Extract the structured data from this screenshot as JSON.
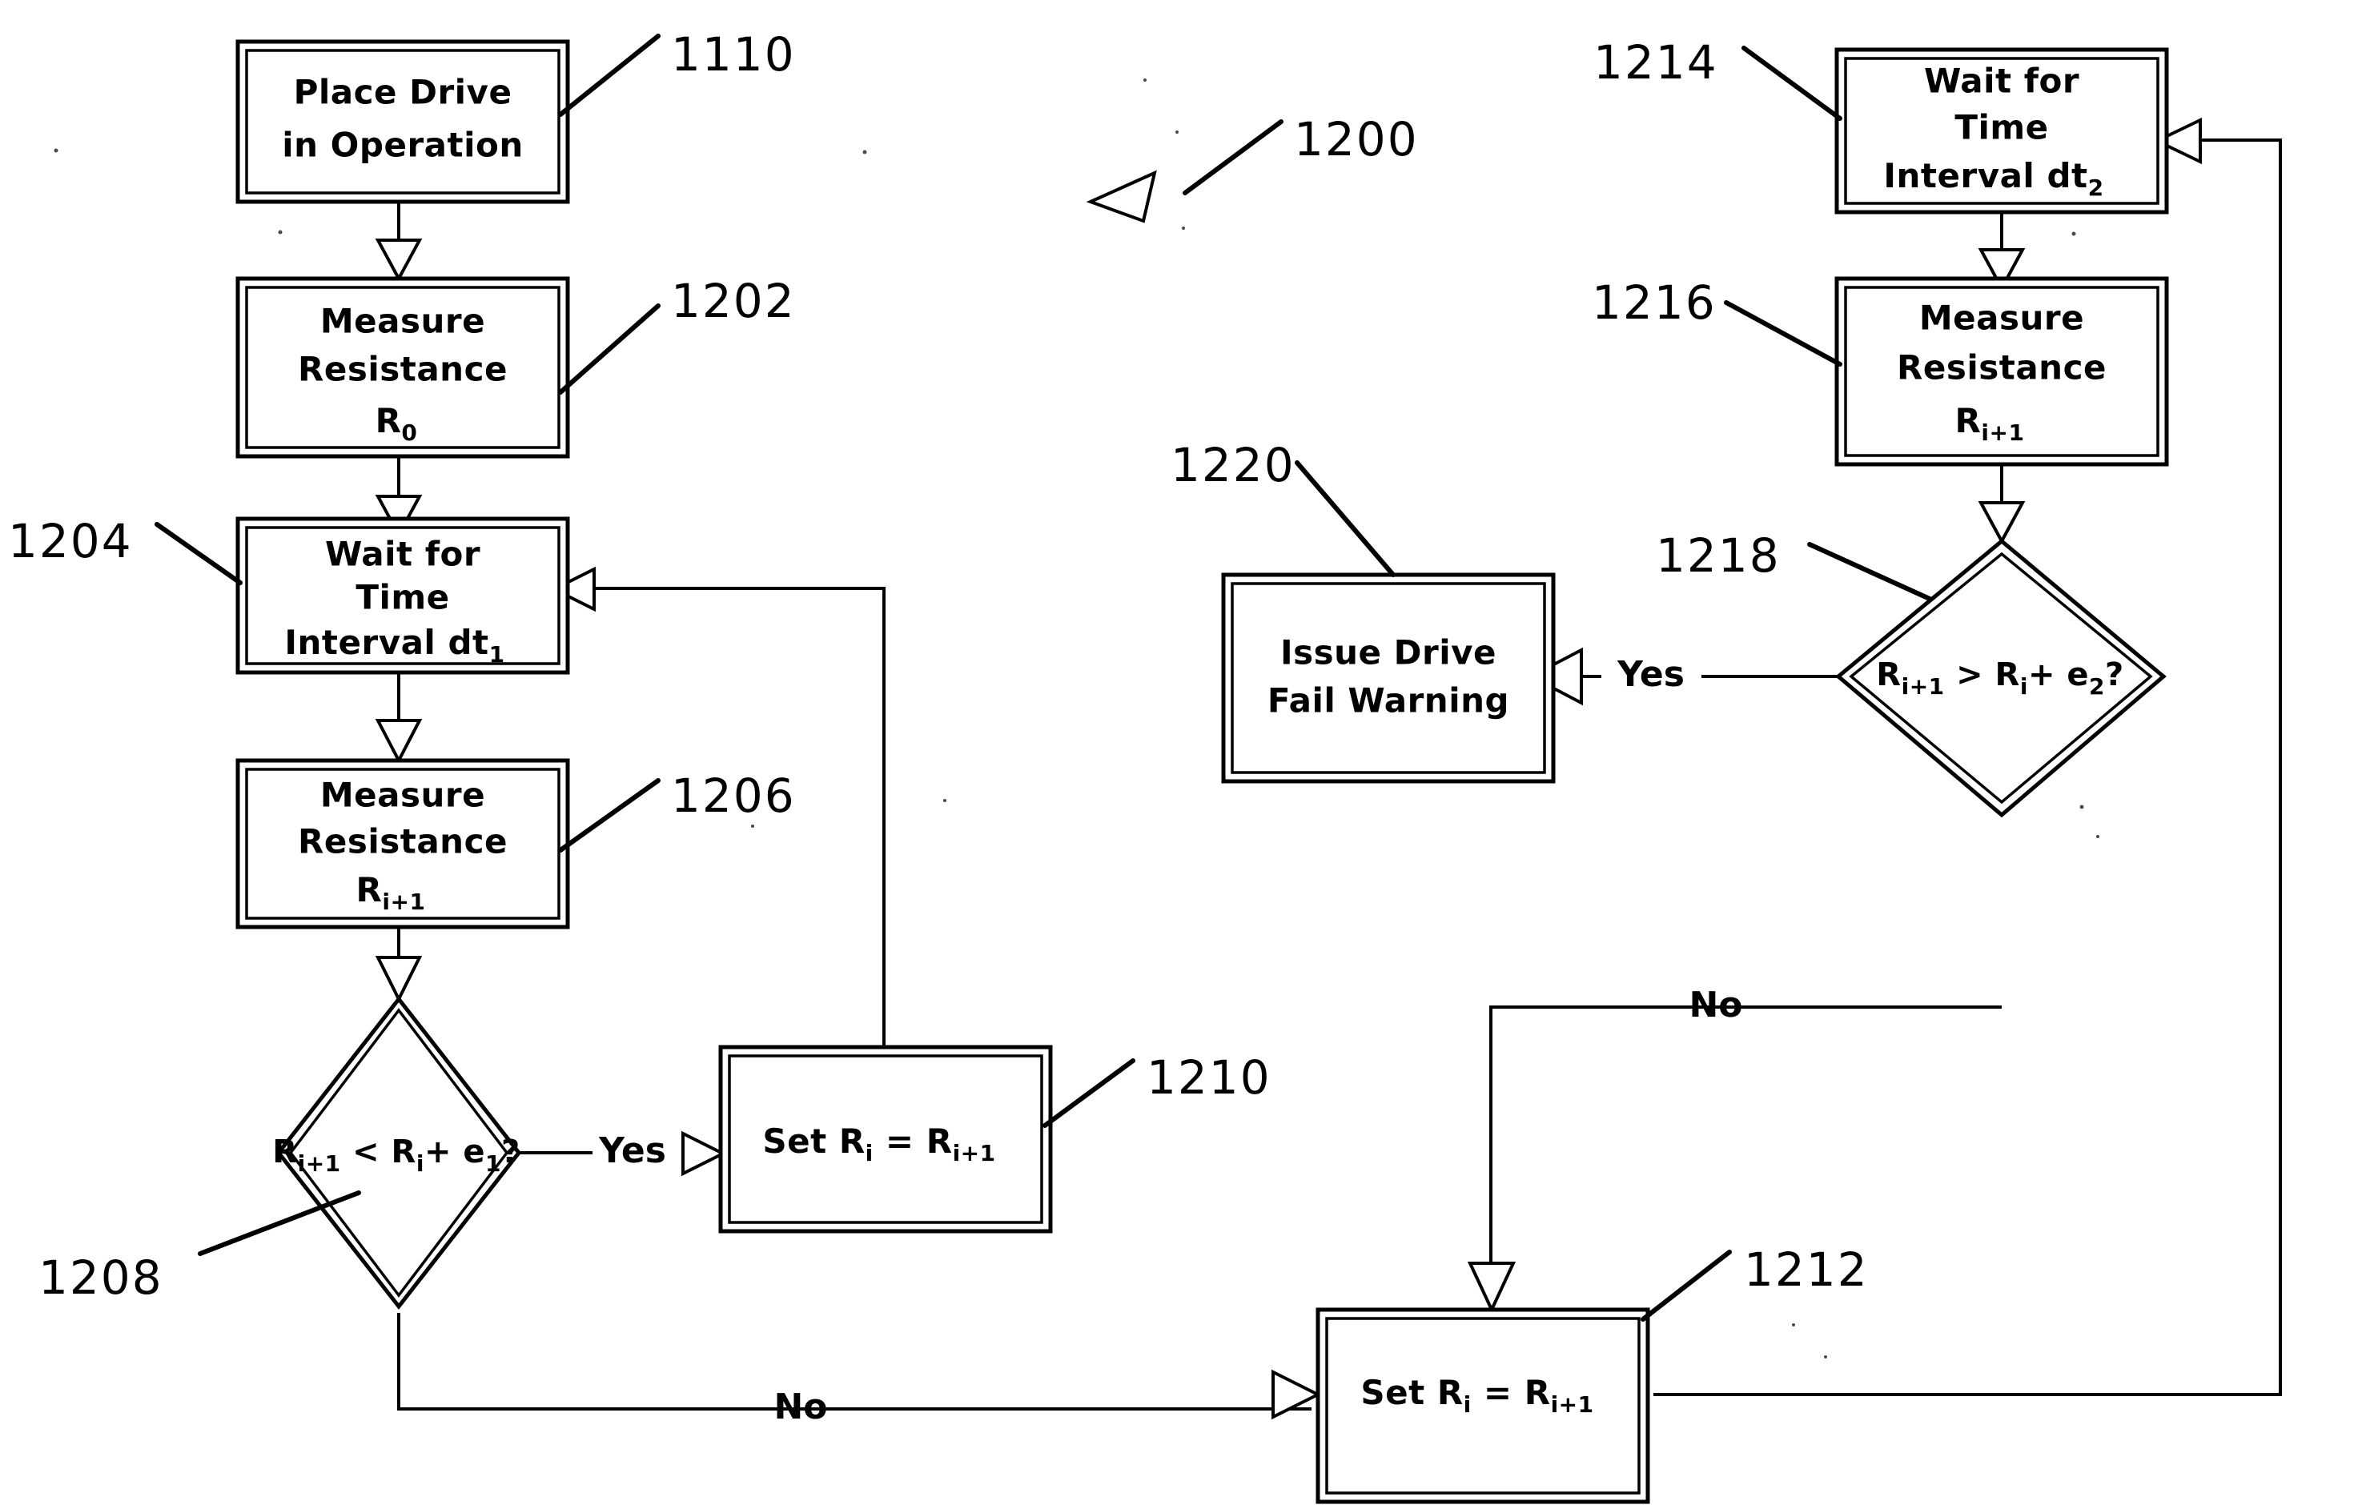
{
  "figure": {
    "name": "figure-1200",
    "reference_numeral": "1200",
    "type": "patent-flowchart",
    "background_color": "#ffffff",
    "line_color": "#000000"
  },
  "nodes": [
    {
      "id": "1110",
      "ref": "1110",
      "shape": "process",
      "lines": [
        "Place Drive",
        "in Operation"
      ]
    },
    {
      "id": "1202",
      "ref": "1202",
      "shape": "process",
      "lines": [
        "Measure",
        "Resistance",
        "R"
      ],
      "subscript": "0"
    },
    {
      "id": "1204",
      "ref": "1204",
      "shape": "process",
      "lines": [
        "Wait for",
        "Time",
        "Interval dt"
      ],
      "subscript": "1"
    },
    {
      "id": "1206",
      "ref": "1206",
      "shape": "process",
      "lines": [
        "Measure",
        "Resistance",
        "R"
      ],
      "subscript": "i+1"
    },
    {
      "id": "1208",
      "ref": "1208",
      "shape": "decision",
      "expr": "R_{i+1} < R_i + e_1 ?",
      "parts": [
        "R",
        "i+1",
        " < ",
        "R",
        "i",
        "+ ",
        "e",
        "1",
        "?"
      ]
    },
    {
      "id": "1210",
      "ref": "1210",
      "shape": "process",
      "expr": "Set R_i = R_{i+1}"
    },
    {
      "id": "1212",
      "ref": "1212",
      "shape": "process",
      "expr": "Set R_i = R_{i+1}"
    },
    {
      "id": "1214",
      "ref": "1214",
      "shape": "process",
      "lines": [
        "Wait for",
        "Time",
        "Interval dt"
      ],
      "subscript": "2"
    },
    {
      "id": "1216",
      "ref": "1216",
      "shape": "process",
      "lines": [
        "Measure",
        "Resistance",
        "R"
      ],
      "subscript": "i+1"
    },
    {
      "id": "1218",
      "ref": "1218",
      "shape": "decision",
      "expr": "R_{i+1} > R_i + e_2 ?"
    },
    {
      "id": "1220",
      "ref": "1220",
      "shape": "process",
      "lines": [
        "Issue Drive",
        "Fail Warning"
      ]
    }
  ],
  "text": {
    "place_drive_l1": "Place Drive",
    "place_drive_l2": "in Operation",
    "measure_l1": "Measure",
    "measure_l2": "Resistance",
    "wait_l1": "Wait for",
    "wait_l2": "Time",
    "wait_l3": "Interval dt",
    "r_symbol": "R",
    "sub_zero": "0",
    "sub_i_plus_1": "i+1",
    "sub_i": "i",
    "sub_1": "1",
    "sub_2": "2",
    "issue_l1": "Issue Drive",
    "issue_l2": "Fail Warning",
    "set_prefix": "Set R",
    "set_eq": " = R",
    "lt_op": " < R",
    "gt_op": " > R",
    "plus_e": "+ e",
    "question": "?",
    "yes": "Yes",
    "no": "No"
  },
  "refs": {
    "r1110": "1110",
    "r1200": "1200",
    "r1202": "1202",
    "r1204": "1204",
    "r1206": "1206",
    "r1208": "1208",
    "r1210": "1210",
    "r1212": "1212",
    "r1214": "1214",
    "r1216": "1216",
    "r1218": "1218",
    "r1220": "1220"
  },
  "edge_labels": {
    "yes_left": "Yes",
    "no_left": "No",
    "yes_right": "Yes",
    "no_right": "No"
  },
  "flow": [
    {
      "from": "1110",
      "to": "1202",
      "label": ""
    },
    {
      "from": "1202",
      "to": "1204",
      "label": ""
    },
    {
      "from": "1204",
      "to": "1206",
      "label": ""
    },
    {
      "from": "1206",
      "to": "1208",
      "label": ""
    },
    {
      "from": "1208",
      "to": "1210",
      "label": "Yes"
    },
    {
      "from": "1208",
      "to": "1212",
      "label": "No"
    },
    {
      "from": "1210",
      "to": "1204",
      "label": ""
    },
    {
      "from": "1212",
      "to": "1214",
      "label": ""
    },
    {
      "from": "1214",
      "to": "1216",
      "label": ""
    },
    {
      "from": "1216",
      "to": "1218",
      "label": ""
    },
    {
      "from": "1218",
      "to": "1220",
      "label": "Yes"
    },
    {
      "from": "1218",
      "to": "1212",
      "label": "No"
    }
  ]
}
